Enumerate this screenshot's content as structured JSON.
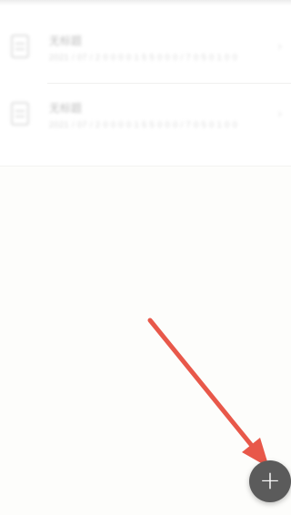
{
  "list": {
    "items": [
      {
        "title": "无标题",
        "subtitle": "2021 / 07 / 2 0 0 0  0 1 5 5 0 0 0  /  7 0 5 0 1 0 0",
        "icon": "document-icon"
      },
      {
        "title": "无标题",
        "subtitle": "2021 / 07 / 2 0 0 0  0 1 5 5 0 0 0  /  7 0 5 0 1 0 0",
        "icon": "document-icon"
      }
    ]
  },
  "fab": {
    "icon": "plus-icon",
    "glyph": "+",
    "color": "#5b5b5b"
  },
  "annotation": {
    "type": "arrow",
    "color": "#e8584a"
  }
}
